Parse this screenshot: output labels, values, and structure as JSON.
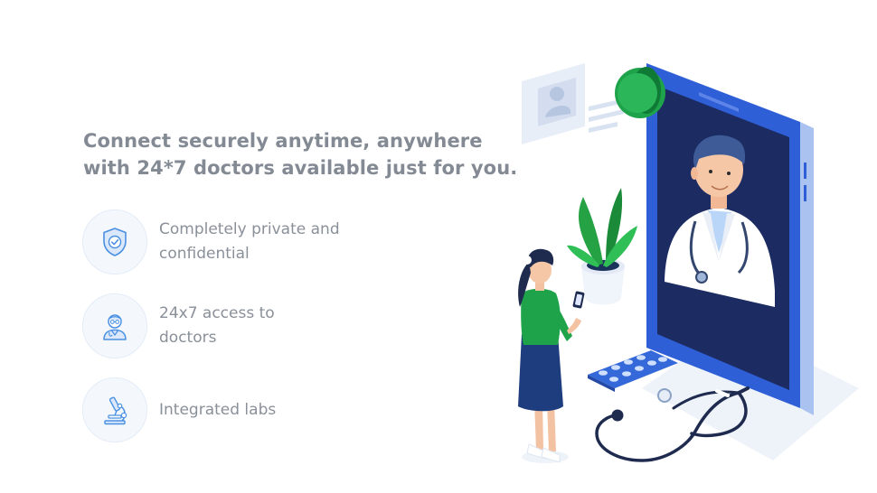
{
  "headline": {
    "line1": "Connect securely anytime, anywhere",
    "line2": "with 24*7 doctors available just for you."
  },
  "features": [
    {
      "icon": "shield-check-icon",
      "line1": "Completely private and",
      "line2": "confidential"
    },
    {
      "icon": "doctor-icon",
      "line1": "24x7 access to",
      "line2": "doctors"
    },
    {
      "icon": "microscope-icon",
      "line1": "Integrated labs",
      "line2": ""
    }
  ],
  "colors": {
    "headline": "#838a94",
    "feature_text": "#8a9099",
    "icon_stroke": "#4a90e2",
    "icon_bg": "#f4f8fd",
    "phone_blue": "#2f5fd6",
    "screen_navy": "#1c2c63",
    "accent_green": "#1fa34a"
  }
}
